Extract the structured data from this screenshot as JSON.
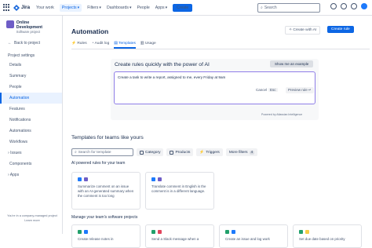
{
  "topbar": {
    "app_name": "Jira",
    "nav": [
      "Your work",
      "Projects",
      "Filters",
      "Dashboards",
      "People",
      "Apps"
    ],
    "create_label": "Create",
    "search_placeholder": "Search"
  },
  "sidebar": {
    "project_name": "Online Development",
    "project_type": "Software project",
    "back_label": "Back to project",
    "section_title": "Project settings",
    "items": [
      "Details",
      "Summary",
      "People",
      "Automation",
      "Features",
      "Notifications",
      "Automations",
      "Workflows",
      "Issues",
      "Components",
      "Apps"
    ],
    "footnote_line1": "You're in a company-managed project",
    "footnote_line2": "Learn more"
  },
  "main": {
    "title": "Automation",
    "create_with_ai_label": "Create with AI",
    "create_rule_label": "Create rule",
    "tabs": [
      "Rules",
      "Audit log",
      "Templates",
      "Usage"
    ],
    "ai": {
      "heading": "Create rules quickly with the power of AI",
      "show_me_label": "Show me an example",
      "prompt_text": "Create a task to write a report, assigned to me, every Friday at 9am",
      "cancel_label": "Cancel",
      "esc_label": "Esc",
      "preview_label": "Preview rule",
      "powered_label": "Powered by Atlassian Intelligence"
    },
    "templates_heading": "Templates for teams like yours",
    "filters": {
      "search_placeholder": "Search for template",
      "chips": [
        "Category",
        "Products",
        "Triggers",
        "More filters"
      ],
      "more_count": "4"
    },
    "ai_section_title": "AI powered rules for your team",
    "ai_cards": [
      "Summarize comment on an issue with an AI-generated summary when the comment is too long",
      "Translate comment in English is the comment is in a different language."
    ],
    "manage_section_title": "Manage your team's software projects",
    "manage_cards": [
      "Create release notes in",
      "Send a Slack message when a",
      "Create an issue and log work",
      "Set due date based on priority"
    ]
  },
  "colors": {
    "accent": "#0c66e4",
    "ai_border": "#8f7ee7"
  }
}
